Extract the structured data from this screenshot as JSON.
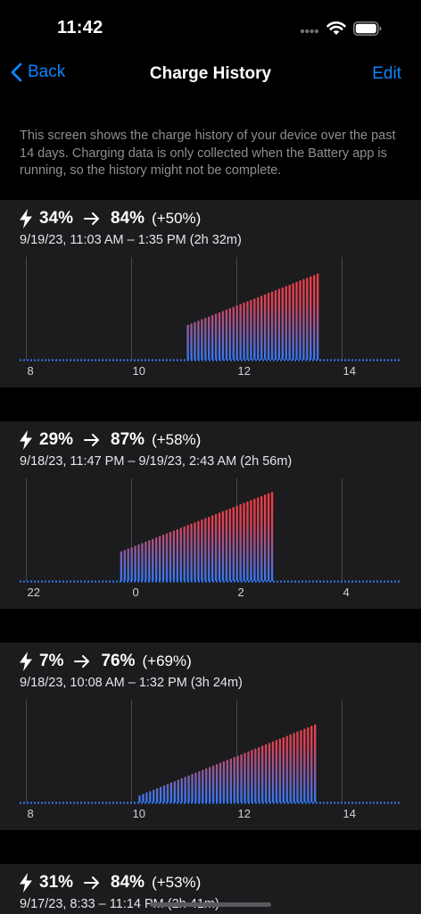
{
  "status_bar": {
    "time": "11:42"
  },
  "nav": {
    "back_label": "Back",
    "title": "Charge History",
    "edit_label": "Edit"
  },
  "intro_text": "This screen shows the charge history of your device over the past 14 days. Charging data is only collected when the Battery app is running, so the history might not be complete.",
  "colors": {
    "accent": "#0a84ff",
    "bar_top": "#ff3b30",
    "bar_bottom": "#3478f6",
    "card_bg": "#1c1c1e"
  },
  "sessions": [
    {
      "from": "34%",
      "to": "84%",
      "delta": "(+50%)",
      "range": "9/19/23, 11:03 AM – 1:35 PM (2h 32m)",
      "chart_data": {
        "type": "bar",
        "x_range": [
          7.5,
          15.5
        ],
        "ticks": [
          8,
          10,
          12,
          14
        ],
        "tick_labels": [
          "8",
          "10",
          "12",
          "14"
        ],
        "start_hour": 11.05,
        "end_hour": 13.583,
        "start_level": 34,
        "end_level": 84,
        "ylim": [
          0,
          100
        ]
      }
    },
    {
      "from": "29%",
      "to": "87%",
      "delta": "(+58%)",
      "range": "9/18/23, 11:47 PM – 9/19/23, 2:43 AM (2h 56m)",
      "chart_data": {
        "type": "bar",
        "x_range": [
          -2.5,
          5.5
        ],
        "ticks": [
          -2,
          0,
          2,
          4
        ],
        "tick_labels": [
          "22",
          "0",
          "2",
          "4"
        ],
        "start_hour": -0.217,
        "end_hour": 2.717,
        "start_level": 29,
        "end_level": 87,
        "ylim": [
          0,
          100
        ]
      }
    },
    {
      "from": "7%",
      "to": "76%",
      "delta": "(+69%)",
      "range": "9/18/23, 10:08 AM – 1:32 PM (3h 24m)",
      "chart_data": {
        "type": "bar",
        "x_range": [
          7.5,
          15.5
        ],
        "ticks": [
          8,
          10,
          12,
          14
        ],
        "tick_labels": [
          "8",
          "10",
          "12",
          "14"
        ],
        "start_hour": 10.133,
        "end_hour": 13.533,
        "start_level": 7,
        "end_level": 76,
        "ylim": [
          0,
          100
        ]
      }
    },
    {
      "from": "31%",
      "to": "84%",
      "delta": "(+53%)",
      "range": "9/17/23, 8:33 – 11:14 PM (2h 41m)",
      "chart_data": null
    }
  ]
}
